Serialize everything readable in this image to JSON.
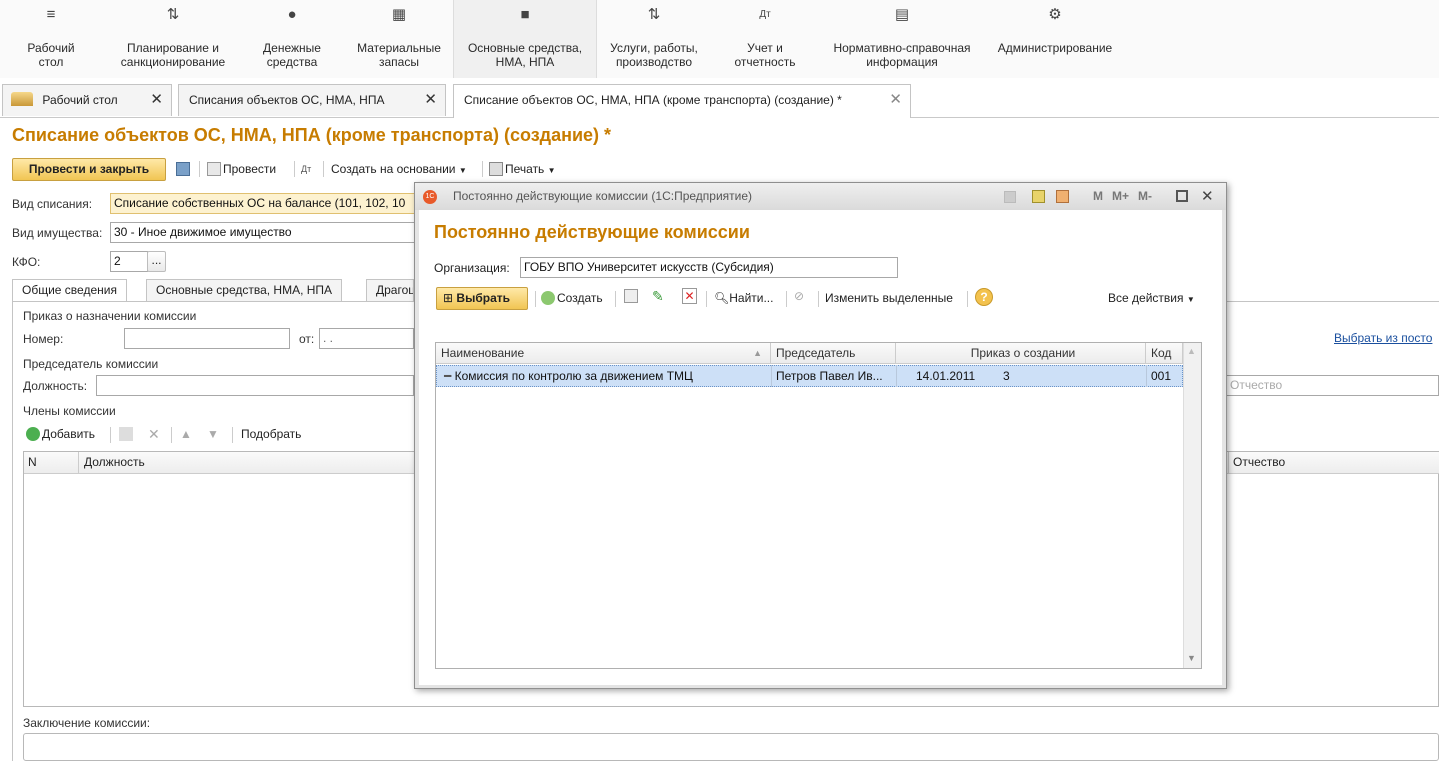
{
  "sections": [
    {
      "label": "Рабочий\nстол",
      "icon": "menu-icon"
    },
    {
      "label": "Планирование и\nсанкционирование",
      "icon": "plan-icon"
    },
    {
      "label": "Денежные\nсредства",
      "icon": "money-icon"
    },
    {
      "label": "Материальные\nзапасы",
      "icon": "inventory-icon"
    },
    {
      "label": "Основные средства,\nНМА, НПА",
      "icon": "truck-icon"
    },
    {
      "label": "Услуги, работы,\nпроизводство",
      "icon": "services-icon"
    },
    {
      "label": "Учет и\nотчетность",
      "icon": "accounting-icon"
    },
    {
      "label": "Нормативно-справочная\nинформация",
      "icon": "reference-icon"
    },
    {
      "label": "Администрирование",
      "icon": "gear-icon"
    }
  ],
  "tabs": [
    {
      "label": "Рабочий стол"
    },
    {
      "label": "Списания объектов ОС, НМА, НПА"
    },
    {
      "label": "Списание объектов ОС, НМА, НПА (кроме транспорта) (создание) *"
    }
  ],
  "form": {
    "title": "Списание объектов ОС, НМА, НПА (кроме транспорта) (создание) *",
    "toolbar": {
      "post_close": "Провести и закрыть",
      "post": "Провести",
      "create_based": "Создать на основании",
      "print": "Печать"
    },
    "writeoff_type_label": "Вид списания:",
    "writeoff_type_value": "Списание собственных ОС на балансе (101, 102, 10",
    "property_type_label": "Вид имущества:",
    "property_type_value": "30 - Иное движимое имущество",
    "kfo_label": "КФО:",
    "kfo_value": "2",
    "kfo_btn": "...",
    "form_tabs": [
      "Общие сведения",
      "Основные средства, НМА, НПА",
      "Драгоц"
    ],
    "order_label": "Приказ о назначении комиссии",
    "number_label": "Номер:",
    "from_label": "от:",
    "date_placeholder": " .  .",
    "chairman_label": "Председатель комиссии",
    "position_label": "Должность:",
    "patronymic_placeholder": "Отчество",
    "select_from_link": "Выбрать из посто",
    "members_label": "Члены комиссии",
    "members_toolbar": {
      "add": "Добавить",
      "pick": "Подобрать"
    },
    "members_columns": {
      "n": "N",
      "position": "Должность",
      "patronymic": "Отчество"
    },
    "conclusion_label": "Заключение комиссии:"
  },
  "dialog": {
    "window_title": "Постоянно действующие комиссии  (1С:Предприятие)",
    "title": "Постоянно действующие комиссии",
    "org_label": "Организация:",
    "org_value": "ГОБУ ВПО Университет искусств (Субсидия)",
    "toolbar": {
      "select": "Выбрать",
      "create": "Создать",
      "find": "Найти...",
      "change_selected": "Изменить выделенные",
      "all_actions": "Все действия"
    },
    "window_buttons": {
      "m": "M",
      "m_plus": "M+",
      "m_minus": "M-"
    },
    "columns": {
      "name": "Наименование",
      "chairman": "Председатель",
      "order": "Приказ о создании",
      "code": "Код"
    },
    "rows": [
      {
        "name": "Комиссия по контролю за движением ТМЦ",
        "chairman": "Петров Павел Ив...",
        "order_date": "14.01.2011",
        "order_no": "3",
        "code": "001"
      }
    ]
  },
  "colors": {
    "accent": "#c77c00",
    "selected_row": "#cde0f7",
    "yellow_button": "#f1c553"
  }
}
